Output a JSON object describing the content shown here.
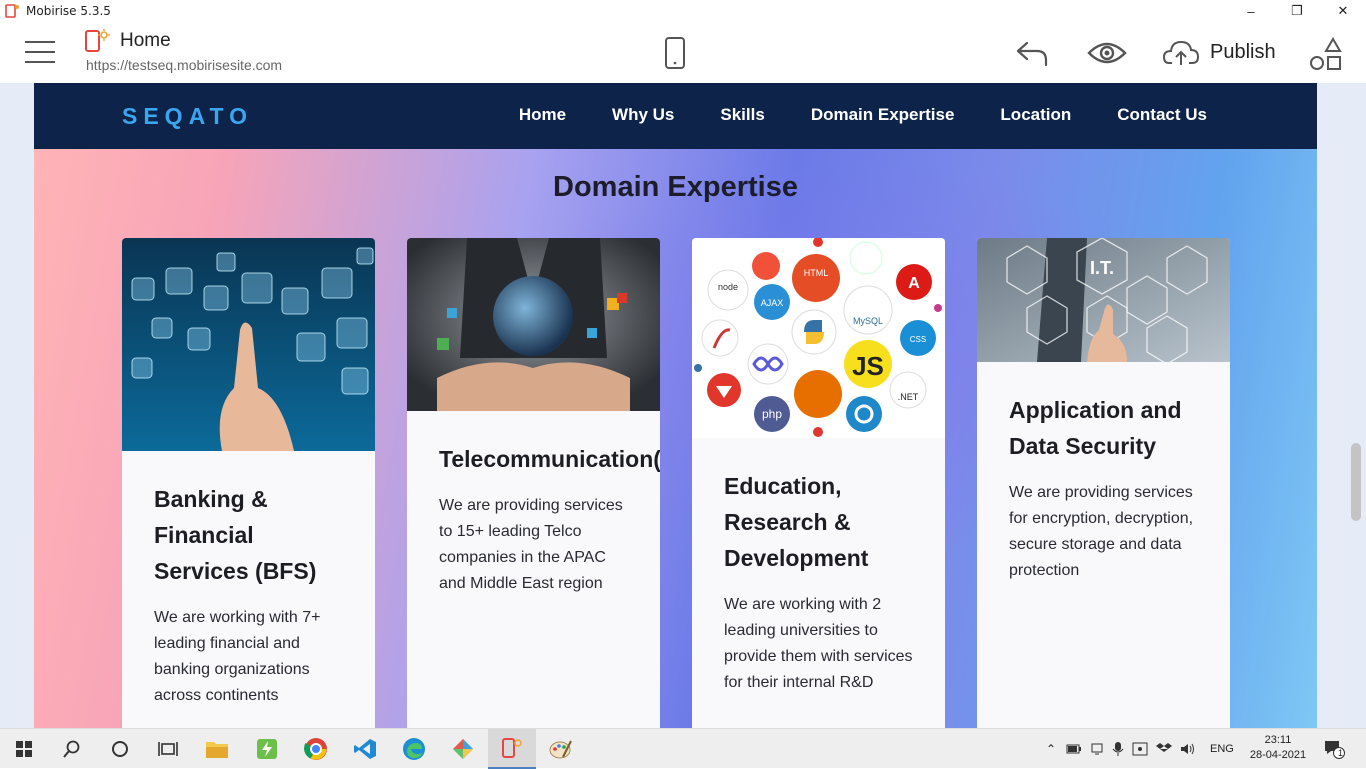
{
  "window": {
    "title": "Mobirise 5.3.5"
  },
  "toolbar": {
    "page_name": "Home",
    "page_url": "https://testseq.mobirisesite.com",
    "publish_label": "Publish"
  },
  "site": {
    "brand": "SEQATO",
    "nav": [
      "Home",
      "Why Us",
      "Skills",
      "Domain Expertise",
      "Location",
      "Contact Us"
    ],
    "section_title": "Domain Expertise",
    "cards": [
      {
        "title": "Banking & Financial Services (BFS)",
        "text": "We are working with 7+ leading financial and banking organizations across continents"
      },
      {
        "title": "Telecommunication(TELCO)",
        "text": "We are providing services to 15+ leading Telco companies in the APAC and Middle East region"
      },
      {
        "title": "Education, Research & Development",
        "text": "We are working with 2 leading universities to provide them with services for their internal R&D"
      },
      {
        "title": "Application and Data Security",
        "text": "We are providing services for encryption, decryption, secure storage and data protection"
      }
    ],
    "edu_logos": [
      "node",
      "swift",
      "HTML",
      "android",
      "AJAX",
      "A",
      "MySQL",
      "CSS",
      "JS",
      "php",
      ".NET"
    ],
    "security_badge": "I.T."
  },
  "taskbar": {
    "language": "ENG",
    "time": "23:11",
    "date": "28-04-2021",
    "notification_count": "1"
  },
  "colors": {
    "navbar": "#0e234a",
    "brand": "#3aa6f0",
    "fab": "#f05a5a",
    "card_bg": "#f9f9fb"
  }
}
